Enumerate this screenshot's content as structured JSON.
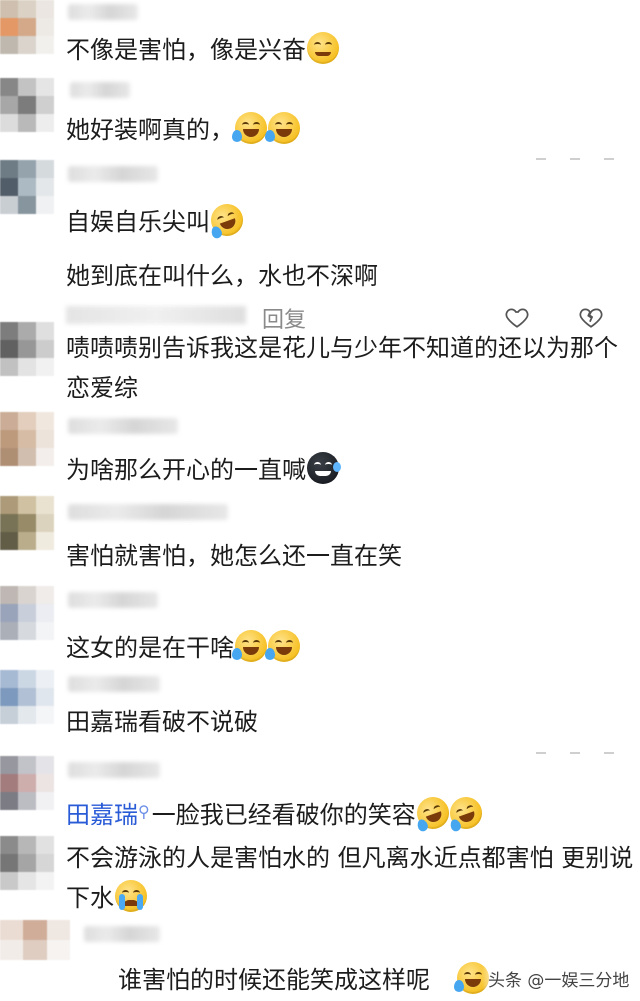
{
  "comments": [
    {
      "text": "不像是害怕，像是兴奋",
      "emoji": "smirk-face"
    },
    {
      "text": "她好装啊真的，",
      "emoji": "tears-of-joy-face"
    },
    {
      "text": "自娱自乐尖叫",
      "emoji": "rolling-laugh-face"
    },
    {
      "text": "她到底在叫什么，水也不深啊",
      "emoji": ""
    },
    {
      "text": "啧啧啧别告诉我这是花儿与少年不知道的还以为那个恋爱综",
      "emoji": ""
    },
    {
      "text": "为啥那么开心的一直喊",
      "emoji": "sweat-dark-face"
    },
    {
      "text": "害怕就害怕，她怎么还一直在笑",
      "emoji": ""
    },
    {
      "text": "这女的是在干啥",
      "emoji": "tears-of-joy-face"
    },
    {
      "text": "田嘉瑞看破不说破",
      "emoji": ""
    },
    {
      "mention": "田嘉瑞",
      "text": "一脸我已经看破你的笑容",
      "emoji": "rolling-laugh-face"
    },
    {
      "text": "不会游泳的人是害怕水的 但凡离水近点都害怕 更别说下水",
      "emoji": "crying-face"
    }
  ],
  "reply_label": "回复",
  "caption": "谁害怕的时候还能笑成这样呢",
  "watermark": "头条 @一娱三分地",
  "icons": {
    "like": "heart-outline-icon",
    "dislike": "broken-heart-icon",
    "search": "search-icon"
  },
  "colors": {
    "mention": "#2a5bd7",
    "muted": "#8a8a8a"
  }
}
